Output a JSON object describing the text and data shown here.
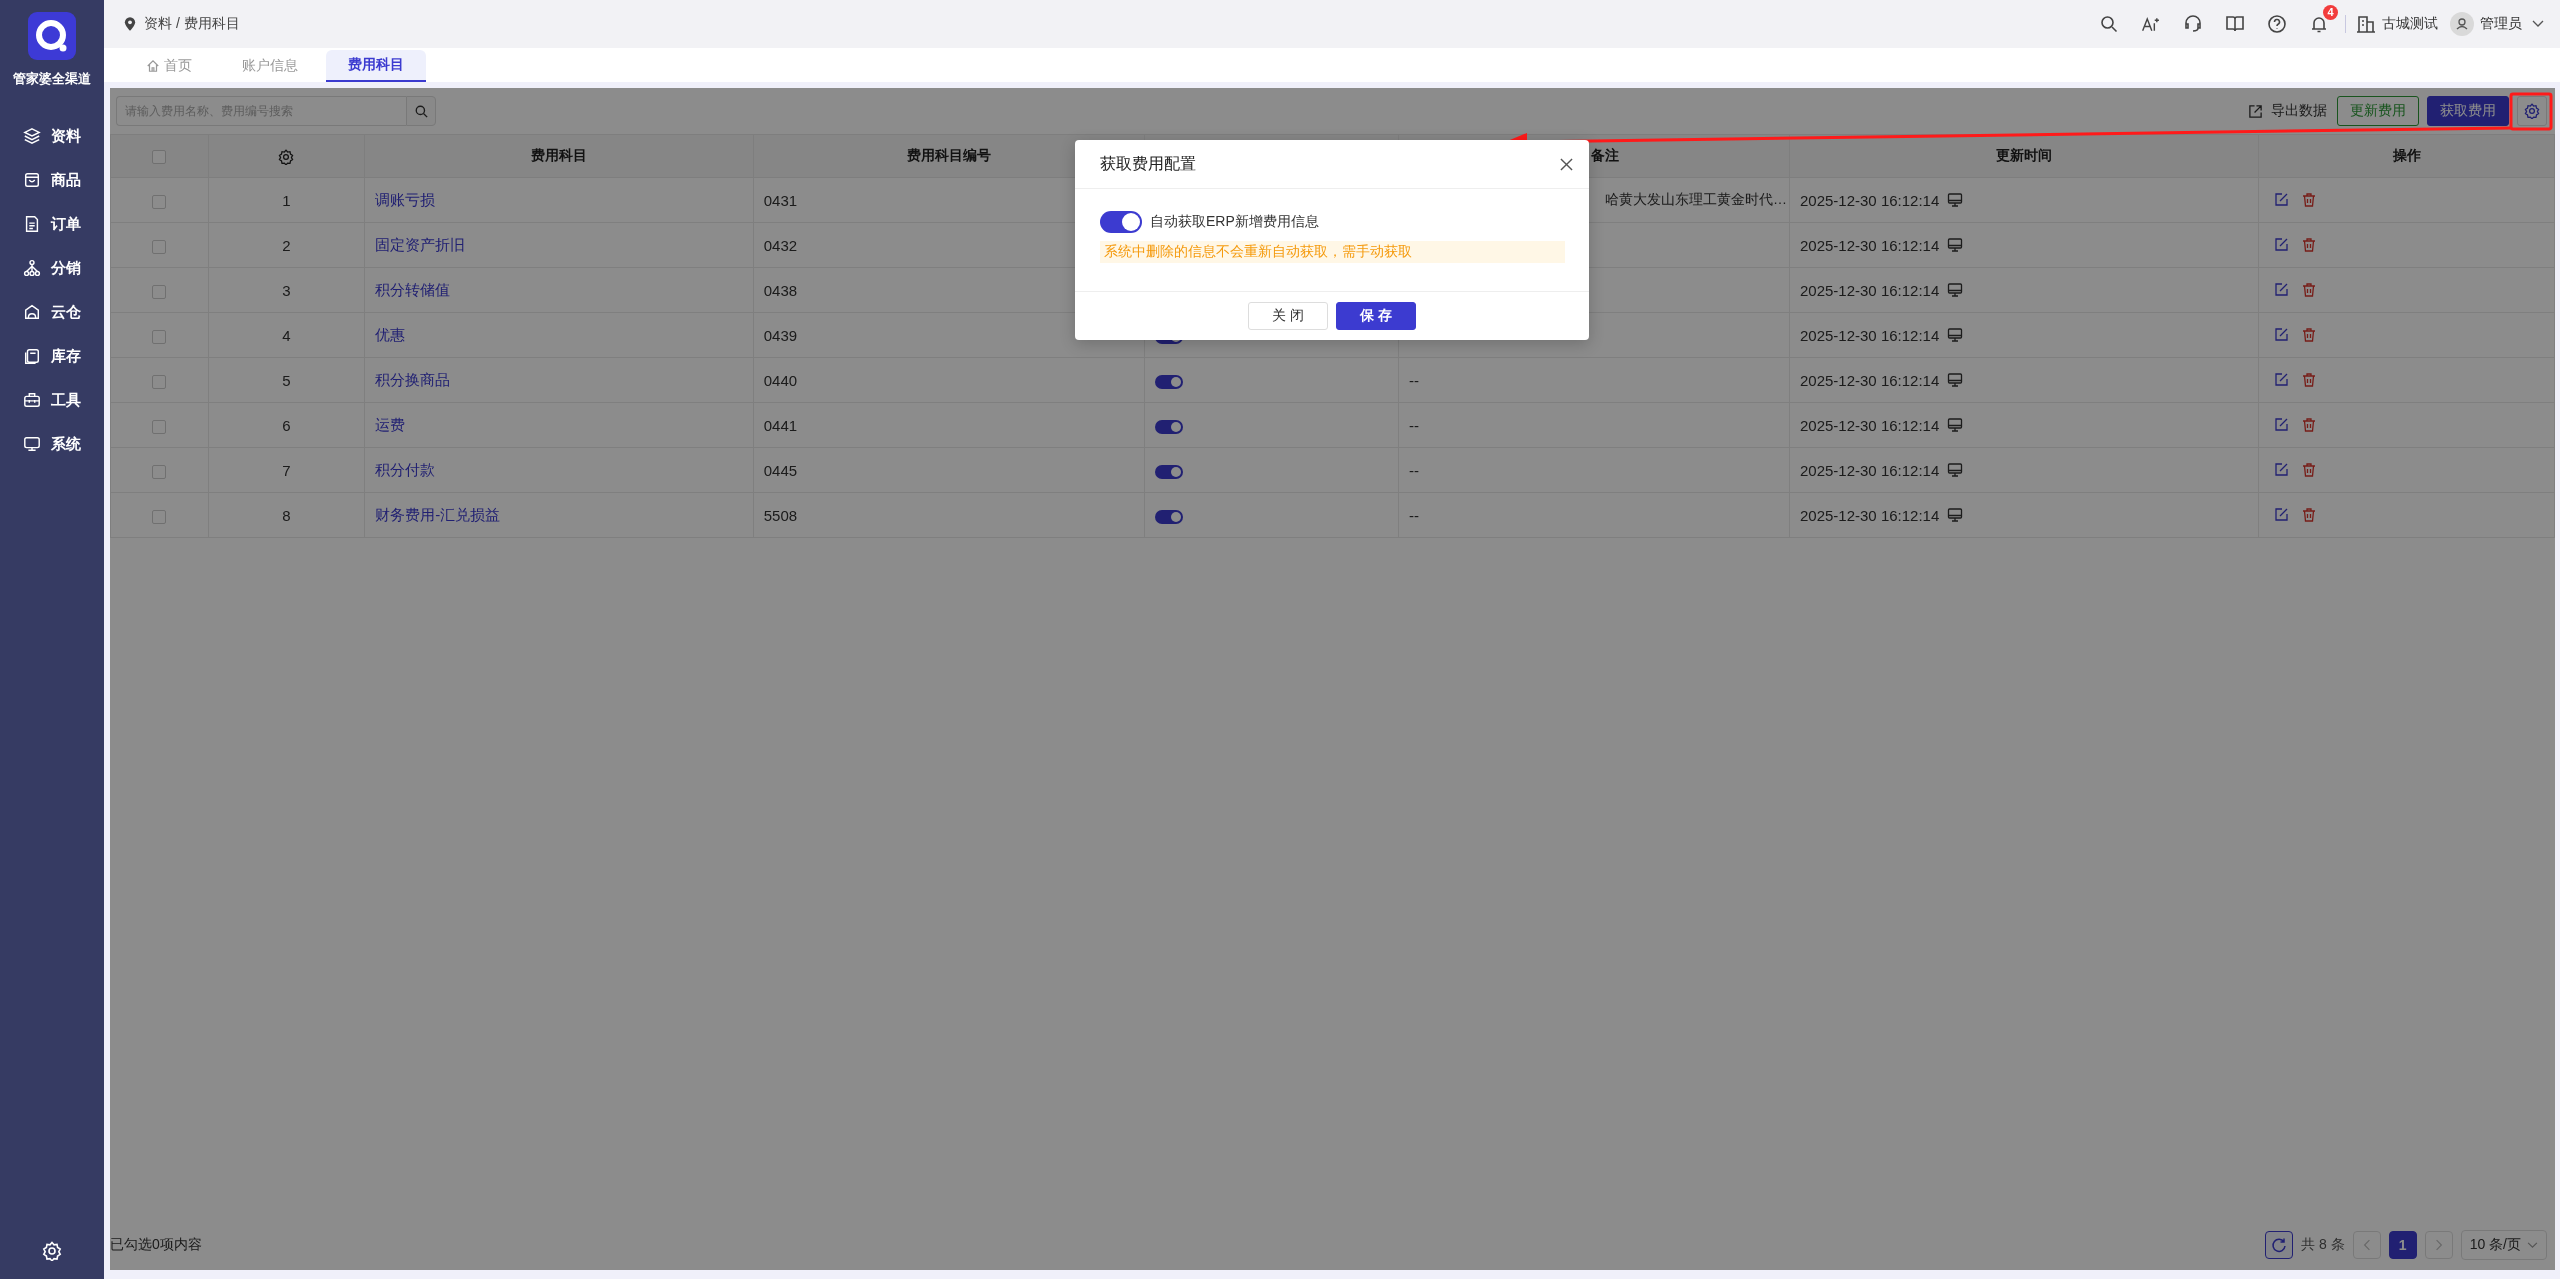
{
  "sidebar": {
    "brand": "管家婆全渠道",
    "items": [
      {
        "label": "资料"
      },
      {
        "label": "商品"
      },
      {
        "label": "订单"
      },
      {
        "label": "分销"
      },
      {
        "label": "云仓"
      },
      {
        "label": "库存"
      },
      {
        "label": "工具"
      },
      {
        "label": "系统"
      }
    ]
  },
  "breadcrumb": "资料 / 费用科目",
  "header": {
    "notification_count": "4",
    "company": "古城测试",
    "user": "管理员"
  },
  "tabs": [
    {
      "label": "首页",
      "selected": false
    },
    {
      "label": "账户信息",
      "selected": false
    },
    {
      "label": "费用科目",
      "selected": true
    }
  ],
  "toolbar": {
    "search": {
      "placeholder": "请输入费用名称、费用编号搜索"
    },
    "export": "导出数据",
    "buttons": [
      {
        "label": "更新费用",
        "kind": "outline"
      },
      {
        "label": "获取费用",
        "kind": "primary"
      }
    ]
  },
  "table": {
    "columns": [
      {
        "kind": "select",
        "checked": false
      },
      {
        "kind": "settings"
      },
      {
        "kind": "label",
        "label": "费用科目"
      },
      {
        "kind": "label",
        "label": "费用科目编号"
      },
      {
        "kind": "covered"
      },
      {
        "kind": "label",
        "label": "备注"
      },
      {
        "kind": "label",
        "label": "更新时间"
      },
      {
        "kind": "label",
        "label": "操作"
      }
    ],
    "rows": [
      {
        "checked": false,
        "index": "1",
        "name": "调账亏损",
        "code": "0431",
        "note": "哈黄大发山东理工黄金时代…",
        "updated": "2025-12-30 16:12:14"
      },
      {
        "checked": false,
        "index": "2",
        "name": "固定资产折旧",
        "code": "0432",
        "updated": "2025-12-30 16:12:14"
      },
      {
        "checked": false,
        "index": "3",
        "name": "积分转储值",
        "code": "0438",
        "updated": "2025-12-30 16:12:14"
      },
      {
        "checked": false,
        "index": "4",
        "name": "优惠",
        "code": "0439",
        "enabled": true,
        "updated": "2025-12-30 16:12:14"
      },
      {
        "checked": false,
        "index": "5",
        "name": "积分换商品",
        "code": "0440",
        "enabled": true,
        "note": "--",
        "updated": "2025-12-30 16:12:14"
      },
      {
        "checked": false,
        "index": "6",
        "name": "运费",
        "code": "0441",
        "enabled": true,
        "note": "--",
        "updated": "2025-12-30 16:12:14"
      },
      {
        "checked": false,
        "index": "7",
        "name": "积分付款",
        "code": "0445",
        "enabled": true,
        "note": "--",
        "updated": "2025-12-30 16:12:14"
      },
      {
        "checked": false,
        "index": "8",
        "name": "财务费用-汇兑损益",
        "code": "5508",
        "enabled": true,
        "note": "--",
        "updated": "2025-12-30 16:12:14"
      }
    ]
  },
  "footer": {
    "selection": "已勾选0项内容",
    "total": "共 8 条",
    "pages": [
      {
        "label": "1",
        "selected": true
      }
    ],
    "page_size": "10 条/页"
  },
  "dialog": {
    "title": "获取费用配置",
    "option": {
      "label": "自动获取ERP新增费用信息",
      "on": true
    },
    "warning": "系统中删除的信息不会重新自动获取，需手动获取",
    "buttons": [
      {
        "label": "关 闭",
        "kind": "default"
      },
      {
        "label": "保 存",
        "kind": "primary"
      }
    ]
  }
}
